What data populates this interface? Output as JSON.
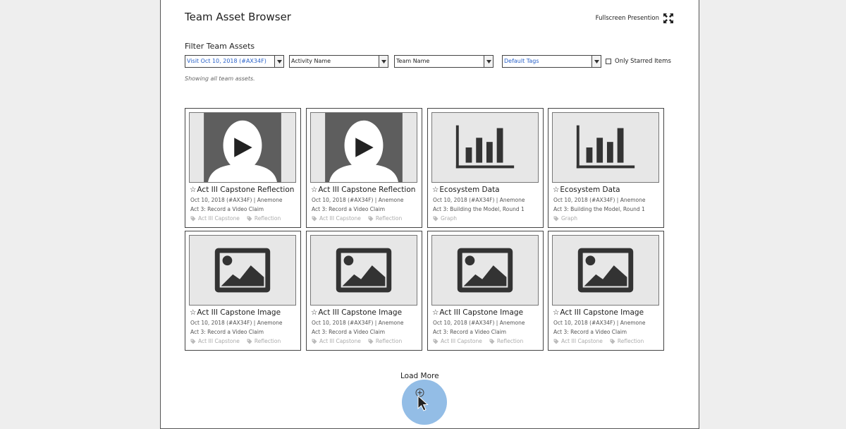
{
  "header": {
    "title": "Team Asset Browser",
    "fullscreen_label": "Fullscreen Presention",
    "fullscreen_icon": "expand-arrows-icon"
  },
  "filters": {
    "heading": "Filter Team Assets",
    "visit": "Visit Oct 10, 2018 (#AX34F)",
    "activity": "Activity Name",
    "team": "Team Name",
    "tags": "Default Tags",
    "starred_label": "Only Starred Items",
    "status": "Showing all team assets."
  },
  "colors": {
    "link_blue": "#2a62c9",
    "halo": "#93bde6",
    "thumb_dark": "#5e5e5e",
    "icon_dark": "#333333"
  },
  "assets": [
    {
      "title": "Act III Capstone Reflection",
      "meta": "Oct 10, 2018 (#AX34F) | Anemone",
      "activity": "Act 3: Record a Video Claim",
      "tags": [
        "Act III Capstone",
        "Reflection"
      ],
      "kind": "video"
    },
    {
      "title": "Act III Capstone Reflection",
      "meta": "Oct 10, 2018 (#AX34F) | Anemone",
      "activity": "Act 3: Record a Video Claim",
      "tags": [
        "Act III Capstone",
        "Reflection"
      ],
      "kind": "video"
    },
    {
      "title": "Ecosystem Data",
      "meta": "Oct 10, 2018 (#AX34F) | Anemone",
      "activity": "Act 3: Building the Model, Round 1",
      "tags": [
        "Graph"
      ],
      "kind": "graph"
    },
    {
      "title": "Ecosystem Data",
      "meta": "Oct 10, 2018 (#AX34F) | Anemone",
      "activity": "Act 3: Building the Model, Round 1",
      "tags": [
        "Graph"
      ],
      "kind": "graph"
    },
    {
      "title": "Act III Capstone Image",
      "meta": "Oct 10, 2018 (#AX34F) | Anemone",
      "activity": "Act 3: Record a Video Claim",
      "tags": [
        "Act III Capstone",
        "Reflection"
      ],
      "kind": "image"
    },
    {
      "title": "Act III Capstone Image",
      "meta": "Oct 10, 2018 (#AX34F) | Anemone",
      "activity": "Act 3: Record a Video Claim",
      "tags": [
        "Act III Capstone",
        "Reflection"
      ],
      "kind": "image"
    },
    {
      "title": "Act III Capstone Image",
      "meta": "Oct 10, 2018 (#AX34F) | Anemone",
      "activity": "Act 3: Record a Video Claim",
      "tags": [
        "Act III Capstone",
        "Reflection"
      ],
      "kind": "image"
    },
    {
      "title": "Act III Capstone Image",
      "meta": "Oct 10, 2018 (#AX34F) | Anemone",
      "activity": "Act 3: Record a Video Claim",
      "tags": [
        "Act III Capstone",
        "Reflection"
      ],
      "kind": "image"
    }
  ],
  "footer": {
    "load_more_label": "Load More"
  }
}
